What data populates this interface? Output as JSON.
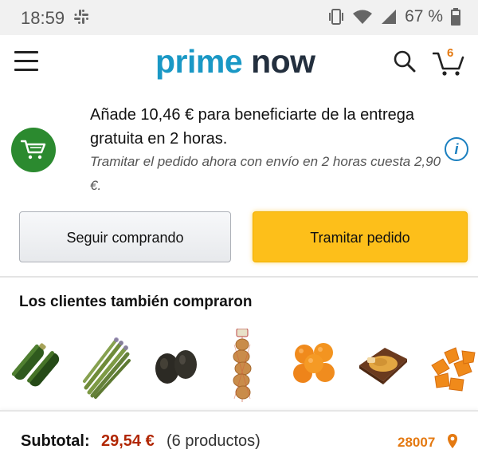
{
  "status_bar": {
    "time": "18:59",
    "battery": "67 %",
    "icons": [
      "slack-icon",
      "vibrate-icon",
      "wifi-icon",
      "signal-icon",
      "battery-icon"
    ]
  },
  "header": {
    "logo_prime": "prime",
    "logo_now": "now",
    "cart_count": "6",
    "icons": [
      "menu-icon",
      "search-icon",
      "cart-icon"
    ]
  },
  "banner": {
    "main_text": "Añade 10,46 € para beneficiarte de la entrega gratuita en 2 horas.",
    "sub_text": "Tramitar el pedido ahora con envío en 2 horas cuesta 2,90 €.",
    "info_glyph": "i"
  },
  "buttons": {
    "continue_label": "Seguir comprando",
    "checkout_label": "Tramitar pedido"
  },
  "recommendations": {
    "title": "Los clientes también compraron",
    "items": [
      "zucchini",
      "asparagus",
      "avocados",
      "onions",
      "oranges",
      "pizza",
      "squash"
    ]
  },
  "footer": {
    "subtotal_label": "Subtotal:",
    "subtotal_amount": "29,54 €",
    "subtotal_count": "(6 productos)",
    "postal_code": "28007"
  },
  "colors": {
    "prime_blue": "#1a98c5",
    "checkout_yellow": "#fdbf1a",
    "price_red": "#b12704",
    "postal_orange": "#e47911",
    "cart_green": "#2b8a2f"
  }
}
